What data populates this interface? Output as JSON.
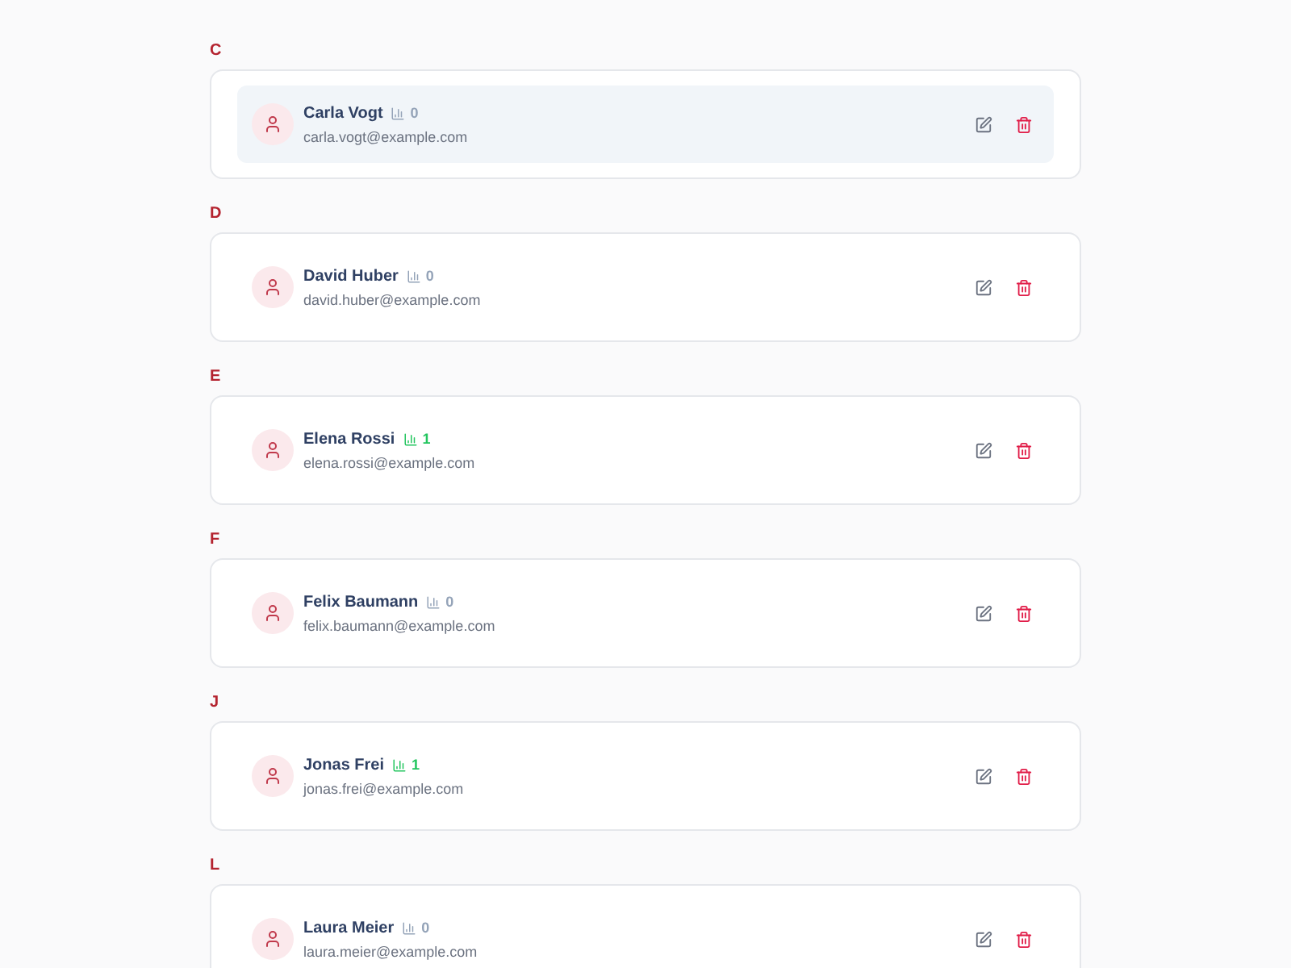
{
  "sections": [
    {
      "letter": "C",
      "contacts": [
        {
          "name": "Carla Vogt",
          "email": "carla.vogt@example.com",
          "stat": {
            "count": "0",
            "color": "#94a3b8"
          },
          "hovered": true
        }
      ]
    },
    {
      "letter": "D",
      "contacts": [
        {
          "name": "David Huber",
          "email": "david.huber@example.com",
          "stat": {
            "count": "0",
            "color": "#94a3b8"
          },
          "hovered": false
        }
      ]
    },
    {
      "letter": "E",
      "contacts": [
        {
          "name": "Elena Rossi",
          "email": "elena.rossi@example.com",
          "stat": {
            "count": "1",
            "color": "#22c55e"
          },
          "hovered": false
        }
      ]
    },
    {
      "letter": "F",
      "contacts": [
        {
          "name": "Felix Baumann",
          "email": "felix.baumann@example.com",
          "stat": {
            "count": "0",
            "color": "#94a3b8"
          },
          "hovered": false
        }
      ]
    },
    {
      "letter": "J",
      "contacts": [
        {
          "name": "Jonas Frei",
          "email": "jonas.frei@example.com",
          "stat": {
            "count": "1",
            "color": "#22c55e"
          },
          "hovered": false
        }
      ]
    },
    {
      "letter": "L",
      "contacts": [
        {
          "name": "Laura Meier",
          "email": "laura.meier@example.com",
          "stat": {
            "count": "0",
            "color": "#94a3b8"
          },
          "hovered": false
        }
      ]
    }
  ]
}
